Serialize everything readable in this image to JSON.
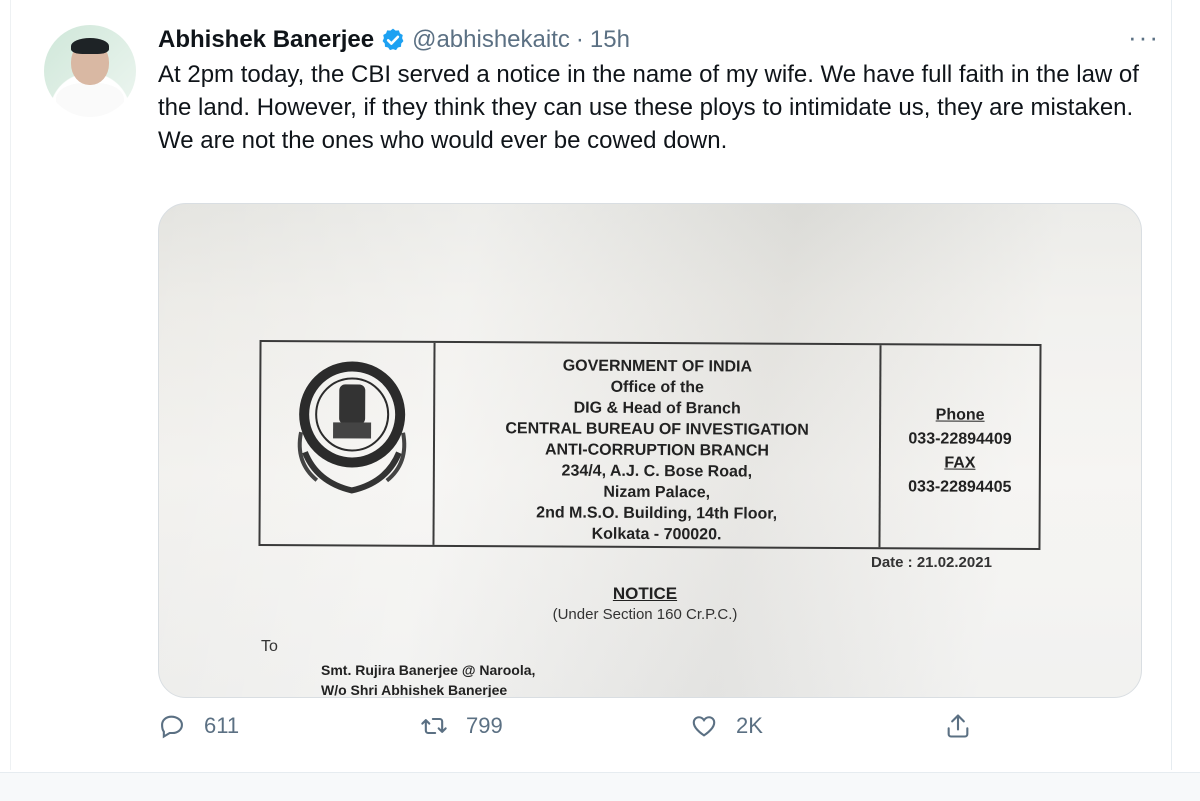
{
  "tweet": {
    "author_name": "Abhishek Banerjee",
    "handle": "@abhishekaitc",
    "separator": "·",
    "time": "15h",
    "more": "···",
    "text": "At 2pm today, the CBI served a notice in the name of my wife. We have full faith in the law of the land. However, if they think they can use these ploys to intimidate us, they are mistaken. We are not the ones who would ever be cowed down."
  },
  "colors": {
    "verified": "#1da1f2",
    "muted": "#5b7083",
    "text": "#0f1419"
  },
  "icons": [
    "verified-badge-icon",
    "more-icon",
    "reply-icon",
    "retweet-icon",
    "like-icon",
    "share-icon"
  ],
  "document": {
    "letterhead": {
      "line1": "GOVERNMENT OF INDIA",
      "line2": "Office of the",
      "line3": "DIG & Head of Branch",
      "line4": "CENTRAL BUREAU OF INVESTIGATION",
      "line5": "ANTI-CORRUPTION BRANCH",
      "line6": "234/4,  A.J. C. Bose Road,",
      "line7": "Nizam Palace,",
      "line8": "2nd M.S.O. Building, 14th Floor,",
      "line9": "Kolkata - 700020.",
      "phone_label": "Phone",
      "phone": "033-22894409",
      "fax_label": "FAX",
      "fax": "033-22894405"
    },
    "date": "Date : 21.02.2021",
    "notice_title": "NOTICE",
    "notice_sub": "(Under Section 160 Cr.P.C.)",
    "to": "To",
    "address_line1": "Smt. Rujira Banerjee @ Naroola,",
    "address_line2": "W/o Shri Abhishek Banerjee"
  },
  "actions": {
    "replies": "611",
    "retweets": "799",
    "likes": "2K"
  }
}
